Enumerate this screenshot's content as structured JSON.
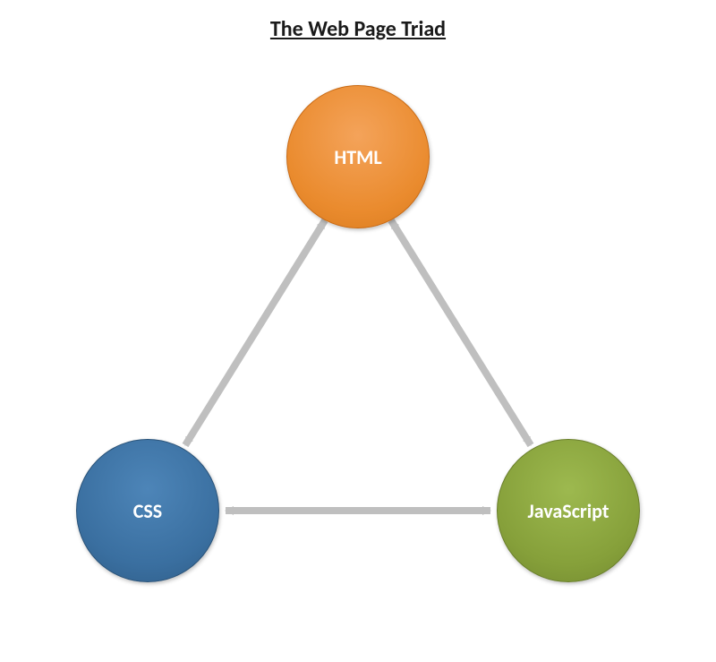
{
  "title": "The Web Page Triad",
  "nodes": {
    "top": {
      "label": "HTML",
      "color": "#ea8b2e"
    },
    "left": {
      "label": "CSS",
      "color": "#3a6fa0"
    },
    "right": {
      "label": "JavaScript",
      "color": "#86a03a"
    }
  },
  "edges": [
    {
      "from": "HTML",
      "to": "CSS",
      "bidirectional": true
    },
    {
      "from": "HTML",
      "to": "JavaScript",
      "bidirectional": true
    },
    {
      "from": "CSS",
      "to": "JavaScript",
      "bidirectional": true
    }
  ],
  "arrow_color": "#bfbfbf"
}
